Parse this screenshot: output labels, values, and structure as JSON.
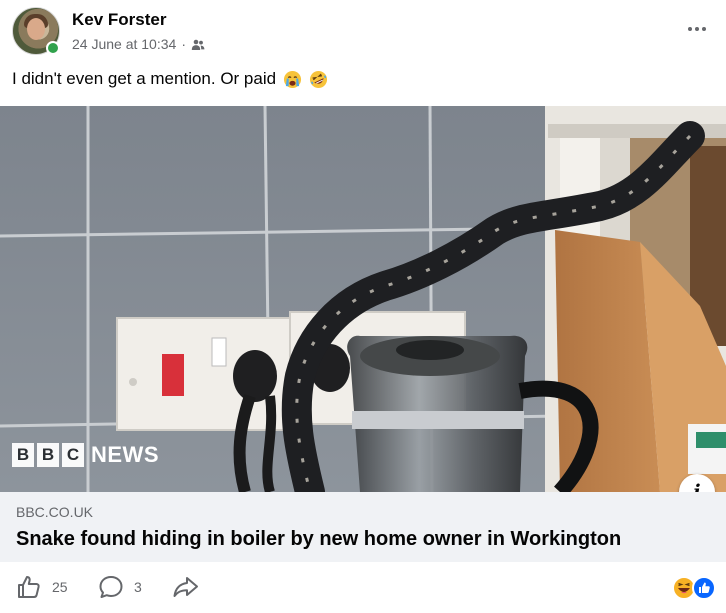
{
  "post": {
    "author": "Kev Forster",
    "timestamp": "24 June at 10:34",
    "separator": "·",
    "audience_icon": "friends-icon",
    "more_icon": "more-horizontal-icon",
    "text": "I didn't even get a mention.  Or paid",
    "emojis": [
      "crying-face-emoji",
      "rolling-on-floor-laughing-emoji"
    ]
  },
  "link_preview": {
    "image_description_icon": "snake-in-boiler-photo",
    "watermark": {
      "letters": [
        "B",
        "B",
        "C"
      ],
      "word": "NEWS"
    },
    "info_label": "i",
    "domain": "BBC.CO.UK",
    "title": "Snake found hiding in boiler by new home owner in Workington"
  },
  "actions": {
    "like": {
      "icon": "thumbs-up-icon",
      "count": "25"
    },
    "comment": {
      "icon": "comment-bubble-icon",
      "count": "3"
    },
    "share": {
      "icon": "share-arrow-icon"
    },
    "reactions": [
      "haha-reaction-icon",
      "like-reaction-icon"
    ]
  },
  "colors": {
    "online": "#31a24c",
    "secondary_text": "#65676b",
    "link_footer_bg": "#f0f2f5",
    "like_blue": "#0866ff",
    "haha_yellow": "#f7b125"
  }
}
